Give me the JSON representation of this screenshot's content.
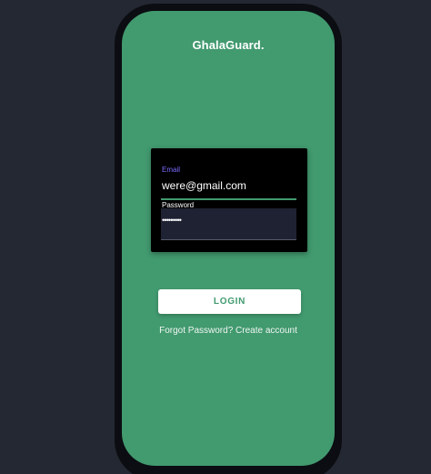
{
  "app": {
    "title": "GhalaGuard."
  },
  "login_form": {
    "email_label": "Email",
    "email_value": "were@gmail.com",
    "password_label": "Password",
    "password_value": "•••••••••"
  },
  "actions": {
    "login_label": "LOGIN",
    "forgot_password_label": "Forgot Password?",
    "create_account_label": "Create account"
  },
  "colors": {
    "app_background": "#242832",
    "screen_green": "#429a6f",
    "card_black": "#000000",
    "email_label": "#7b6cff",
    "button_white": "#ffffff"
  }
}
